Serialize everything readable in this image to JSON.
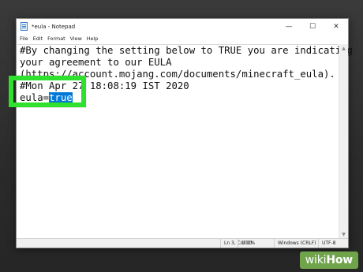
{
  "window": {
    "title": "*eula - Notepad",
    "minimize_glyph": "—",
    "maximize_glyph": "☐",
    "close_glyph": "✕"
  },
  "menu": [
    {
      "label": "File"
    },
    {
      "label": "Edit"
    },
    {
      "label": "Format"
    },
    {
      "label": "View"
    },
    {
      "label": "Help"
    }
  ],
  "editor": {
    "lines": [
      "#By changing the setting below to TRUE you are indicating",
      "your agreement to our EULA",
      "(https://account.mojang.com/documents/minecraft_eula).",
      "#Mon Apr 27 18:08:19 IST 2020"
    ],
    "last_line_prefix": "eula=",
    "last_line_selected": "true"
  },
  "statusbar": {
    "position": "Ln 3, Col 10",
    "zoom": "100%",
    "line_ending": "Windows (CRLF)",
    "encoding": "UTF-8"
  },
  "watermark": {
    "wiki": "wiki",
    "how": "How"
  },
  "colors": {
    "highlight_box": "#2fe02f",
    "selection": "#0078d7",
    "watermark_bg": "#78b250"
  },
  "icons": {
    "app": "notepad-icon",
    "scroll_up": "scroll-up-icon",
    "scroll_down": "scroll-down-icon"
  }
}
